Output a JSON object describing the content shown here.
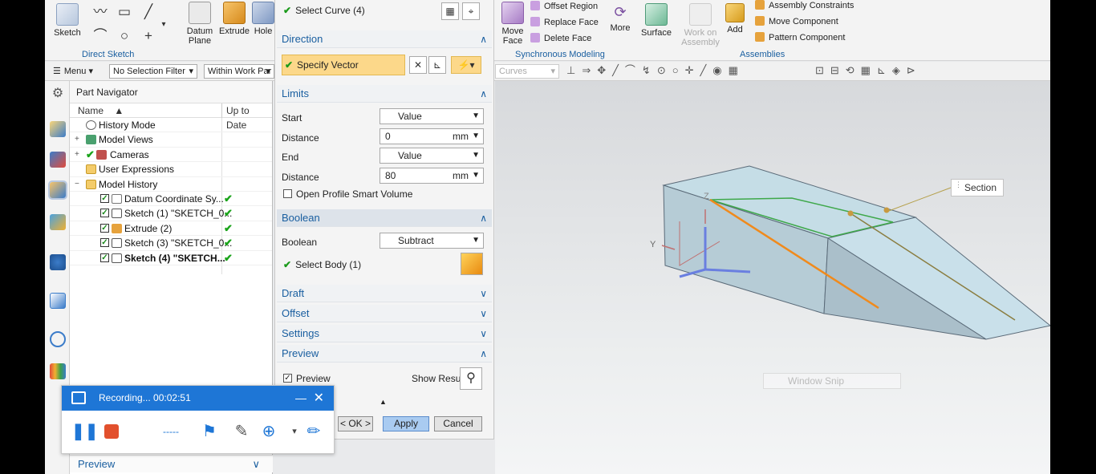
{
  "ribbon": {
    "sketch": "Sketch",
    "direct_sketch": "Direct Sketch",
    "datum_plane": "Datum Plane",
    "extrude": "Extrude",
    "hole": "Hole",
    "move_face": "Move Face",
    "offset_region": "Offset Region",
    "replace_face": "Replace Face",
    "delete_face": "Delete Face",
    "more": "More",
    "surface": "Surface",
    "synchronous_modeling": "Synchronous Modeling",
    "work_on_assembly": "Work on Assembly",
    "add": "Add",
    "assembly_constraints": "Assembly Constraints",
    "move_component": "Move Component",
    "pattern_component": "Pattern Component",
    "assemblies": "Assemblies"
  },
  "toolbar2": {
    "menu": "Menu",
    "selection_filter": "No Selection Filter",
    "scope": "Within Work Par",
    "curves": "Curves"
  },
  "navigator": {
    "title": "Part Navigator",
    "col_name": "Name",
    "col_status": "Up to Date",
    "rows": [
      {
        "label": "History Mode"
      },
      {
        "label": "Model Views"
      },
      {
        "label": "Cameras"
      },
      {
        "label": "User Expressions"
      },
      {
        "label": "Model History"
      },
      {
        "label": "Datum Coordinate Sy..."
      },
      {
        "label": "Sketch (1) \"SKETCH_0..."
      },
      {
        "label": "Extrude (2)"
      },
      {
        "label": "Sketch (3) \"SKETCH_0..."
      },
      {
        "label": "Sketch (4) \"SKETCH..."
      }
    ],
    "preview": "Preview"
  },
  "dialog": {
    "select_curve": "Select Curve (4)",
    "direction": "Direction",
    "specify_vector": "Specify Vector",
    "limits": "Limits",
    "start": "Start",
    "start_value": "Value",
    "distance1_label": "Distance",
    "distance1_value": "0",
    "unit": "mm",
    "end": "End",
    "end_value": "Value",
    "distance2_label": "Distance",
    "distance2_value": "80",
    "open_profile": "Open Profile Smart Volume",
    "boolean_header": "Boolean",
    "boolean_label": "Boolean",
    "boolean_value": "Subtract",
    "select_body": "Select Body (1)",
    "draft": "Draft",
    "offset": "Offset",
    "settings": "Settings",
    "preview_header": "Preview",
    "preview_check": "Preview",
    "show_result": "Show Result",
    "ok": "< OK >",
    "apply": "Apply",
    "cancel": "Cancel"
  },
  "viewport": {
    "section_tag": "Section",
    "window_snip": "Window Snip",
    "axis_y": "Y",
    "axis_z": "Z"
  },
  "recorder": {
    "status": "Recording... 00:02:51"
  },
  "colors": {
    "accent_blue": "#1a5fa0",
    "vector_highlight": "#fcd88a",
    "recorder_header": "#1e76d6",
    "ok_green": "#19a319"
  }
}
